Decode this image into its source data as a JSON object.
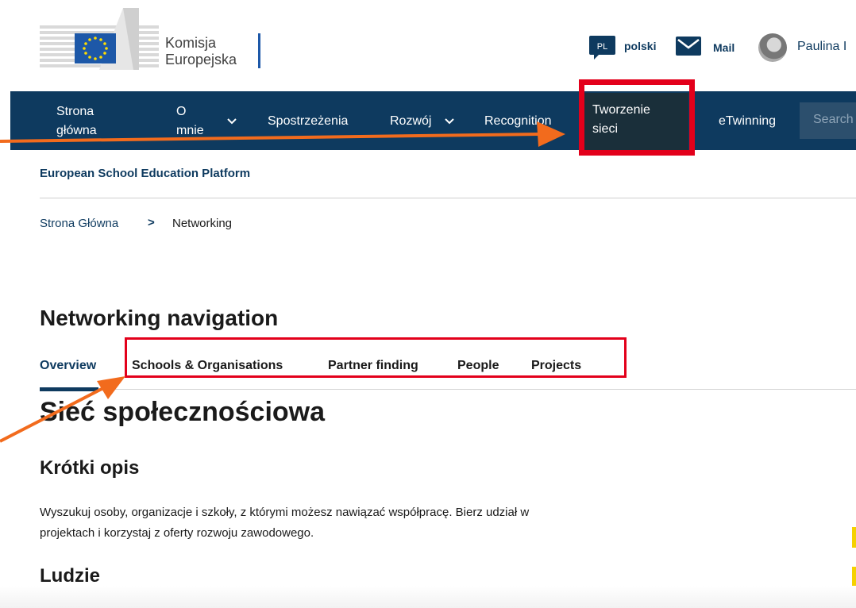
{
  "header": {
    "logo_text_line1": "Komisja",
    "logo_text_line2": "Europejska",
    "language_code": "PL",
    "language_label": "polski",
    "mail_label": "Mail",
    "user_name": "Paulina I"
  },
  "nav": {
    "items": [
      {
        "line1": "Strona",
        "line2": "główna"
      },
      {
        "line1": "O",
        "line2": "mnie"
      },
      {
        "label": "Spostrzeżenia"
      },
      {
        "label": "Rozwój"
      },
      {
        "label": "Recognition"
      },
      {
        "line1": "Tworzenie",
        "line2": "sieci"
      },
      {
        "label": "eTwinning"
      }
    ],
    "search_placeholder": "Search"
  },
  "platform_title": "European School Education Platform",
  "breadcrumb": {
    "home": "Strona Główna",
    "separator": ">",
    "current": "Networking"
  },
  "networking_nav": {
    "title": "Networking navigation",
    "tabs": [
      "Overview",
      "Schools & Organisations",
      "Partner finding",
      "People",
      "Projects"
    ]
  },
  "content": {
    "heading": "Sieć społecznościowa",
    "subheading1": "Krótki opis",
    "paragraph_line1": "Wyszukuj osoby, organizacje i szkoły, z którymi możesz nawiązać współpracę. Bierz udział w",
    "paragraph_line2": "projektach i korzystaj z oferty rozwoju zawodowego.",
    "subheading2": "Ludzie"
  },
  "colors": {
    "nav_bg": "#0e3a5f",
    "highlight": "#e3001b",
    "arrow": "#f26b1d",
    "eu_blue": "#1d58a8",
    "eu_star": "#ffdd00"
  }
}
